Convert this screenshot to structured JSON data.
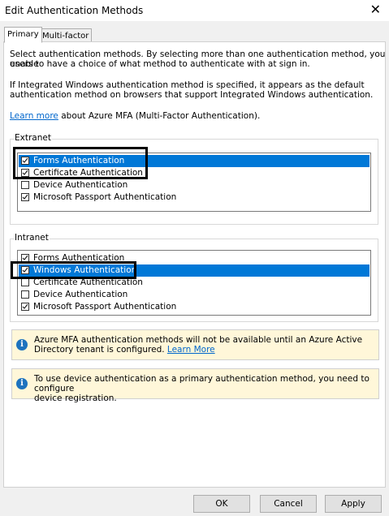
{
  "window": {
    "title": "Edit Authentication Methods",
    "close_glyph": "✕"
  },
  "tabs": [
    {
      "label": "Primary",
      "active": true
    },
    {
      "label": "Multi-factor",
      "active": false
    }
  ],
  "intro": {
    "line1": "Select authentication methods. By selecting more than one authentication method, you enable",
    "line2": "users to have a choice of what method to authenticate with at sign in.",
    "line3": "If Integrated Windows authentication method is specified, it appears as the default",
    "line4": "authentication method on browsers that support Integrated Windows authentication.",
    "learn_more": "Learn more",
    "learn_more_suffix": " about Azure MFA (Multi-Factor Authentication)."
  },
  "extranet": {
    "label": "Extranet",
    "items": [
      {
        "label": "Forms Authentication",
        "checked": true,
        "selected": true
      },
      {
        "label": "Certificate Authentication",
        "checked": true,
        "selected": false
      },
      {
        "label": "Device Authentication",
        "checked": false,
        "selected": false
      },
      {
        "label": "Microsoft Passport Authentication",
        "checked": true,
        "selected": false
      }
    ]
  },
  "intranet": {
    "label": "Intranet",
    "items": [
      {
        "label": "Forms Authentication",
        "checked": true,
        "selected": false
      },
      {
        "label": "Windows Authentication",
        "checked": true,
        "selected": true
      },
      {
        "label": "Certificate Authentication",
        "checked": false,
        "selected": false
      },
      {
        "label": "Device Authentication",
        "checked": false,
        "selected": false
      },
      {
        "label": "Microsoft Passport Authentication",
        "checked": true,
        "selected": false
      }
    ]
  },
  "notices": {
    "mfa_line1": "Azure MFA authentication methods will not be available until an Azure Active",
    "mfa_line2": "Directory tenant is configured. ",
    "mfa_link": "Learn More",
    "device_line1": "To use device authentication as a primary authentication method, you need to configure",
    "device_line2": "device registration.",
    "icon_glyph": "i"
  },
  "buttons": {
    "ok": "OK",
    "cancel": "Cancel",
    "apply": "Apply"
  },
  "colors": {
    "selection": "#0078d7",
    "link": "#0066cc",
    "info_bg": "#fff7d9",
    "info_icon": "#1e73be"
  }
}
